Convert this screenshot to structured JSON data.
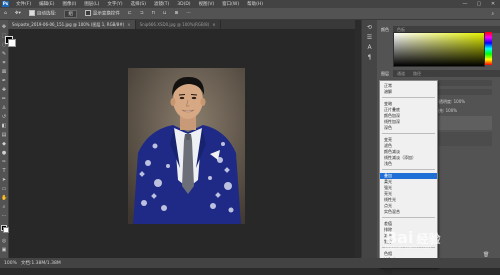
{
  "menu": {
    "logo": "Ps",
    "items": [
      "文件(F)",
      "编辑(E)",
      "图像(I)",
      "图层(L)",
      "文字(Y)",
      "选择(S)",
      "滤镜(T)",
      "3D(D)",
      "视图(V)",
      "窗口(W)",
      "帮助(H)"
    ]
  },
  "window_controls": [
    "—",
    "▢",
    "✕"
  ],
  "options": {
    "auto_select_label": "自动选择:",
    "auto_select_value": "组",
    "show_transform_label": "显示变换控件"
  },
  "tabs": [
    {
      "label": "Snipaste_2019-06-06_151.jpg @ 100% (图层 1, RGB/8#)",
      "active": true
    },
    {
      "label": "Snip666.XSD0.jpg @ 100%(RGB/8)",
      "active": false
    }
  ],
  "status": {
    "zoom": "100%",
    "doc": "文档:1.38M/1.38M"
  },
  "panels": {
    "color_tabs": [
      "颜色",
      "色板"
    ],
    "layer_tabs": [
      "图层",
      "通道",
      "路径"
    ],
    "opacity_label": "不透明度:",
    "opacity_value": "100%",
    "fill_label": "填充:",
    "fill_value": "100%"
  },
  "blend_modes": {
    "groups": [
      [
        "正常",
        "溶解"
      ],
      [
        "变暗",
        "正片叠底",
        "颜色加深",
        "线性加深",
        "深色"
      ],
      [
        "变亮",
        "滤色",
        "颜色减淡",
        "线性减淡（添加）",
        "浅色"
      ],
      [
        "叠加",
        "柔光",
        "强光",
        "亮光",
        "线性光",
        "点光",
        "实色混合"
      ],
      [
        "差值",
        "排除",
        "减去",
        "划分"
      ],
      [
        "色相",
        "饱和度",
        "颜色",
        "明度"
      ]
    ],
    "selected": "叠加"
  },
  "watermark": {
    "brand": "Bai",
    "brand_suffix": "经验",
    "url": "jingyan.baidu.com"
  }
}
